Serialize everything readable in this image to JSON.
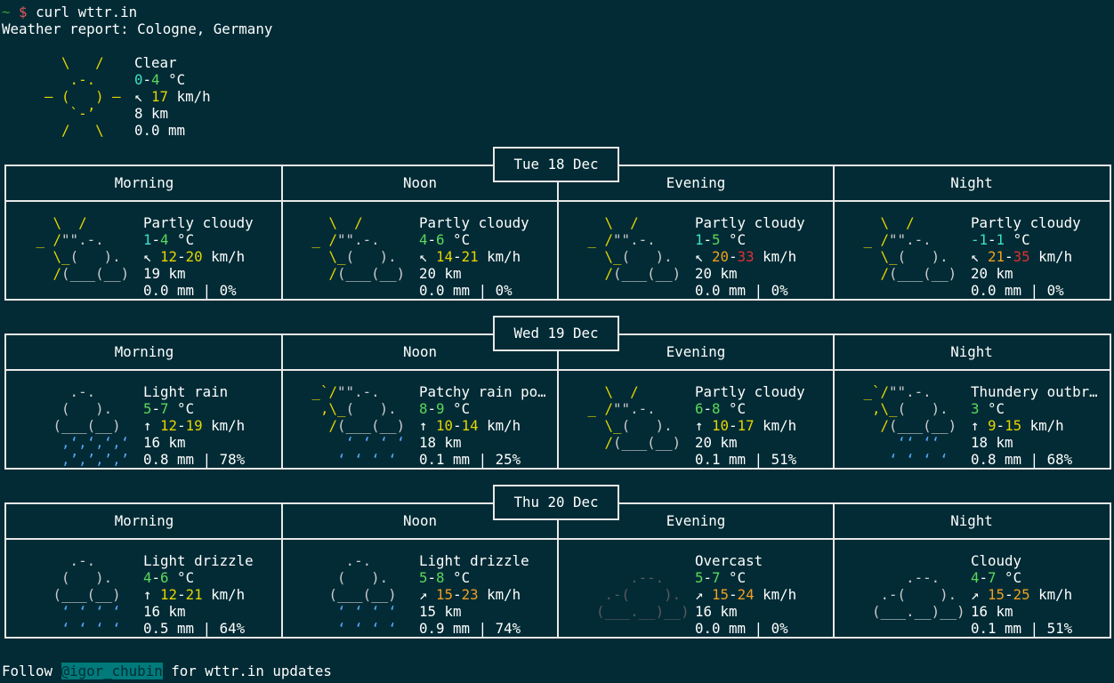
{
  "prompt": {
    "path": "~",
    "symbol": "$",
    "command": "curl wttr.in"
  },
  "report_title": "Weather report: Cologne, Germany",
  "current": {
    "condition": "Clear",
    "temp_low": "0",
    "temp_high": "4",
    "temp_unit": "°C",
    "wind_arrow": "↖",
    "wind": "17",
    "wind_unit": "km/h",
    "visibility": "8 km",
    "precip": "0.0 mm"
  },
  "days": [
    {
      "date": "Tue 18 Dec",
      "periods": [
        {
          "name": "Morning",
          "condition": "Partly cloudy",
          "t1": "1",
          "t2": "4",
          "wind_arrow": "↖",
          "w1": "12",
          "w2": "20",
          "vis": "19 km",
          "precip": "0.0 mm | 0%"
        },
        {
          "name": "Noon",
          "condition": "Partly cloudy",
          "t1": "4",
          "t2": "6",
          "wind_arrow": "↖",
          "w1": "14",
          "w2": "21",
          "vis": "20 km",
          "precip": "0.0 mm | 0%"
        },
        {
          "name": "Evening",
          "condition": "Partly cloudy",
          "t1": "1",
          "t2": "5",
          "wind_arrow": "↖",
          "w1": "20",
          "w2": "33",
          "vis": "20 km",
          "precip": "0.0 mm | 0%"
        },
        {
          "name": "Night",
          "condition": "Partly cloudy",
          "t1": "-1",
          "t2": "1",
          "wind_arrow": "↖",
          "w1": "21",
          "w2": "35",
          "vis": "20 km",
          "precip": "0.0 mm | 0%"
        }
      ]
    },
    {
      "date": "Wed 19 Dec",
      "periods": [
        {
          "name": "Morning",
          "condition": "Light rain",
          "t1": "5",
          "t2": "7",
          "wind_arrow": "↑",
          "w1": "12",
          "w2": "19",
          "vis": "16 km",
          "precip": "0.8 mm | 78%"
        },
        {
          "name": "Noon",
          "condition": "Patchy rain po…",
          "t1": "8",
          "t2": "9",
          "wind_arrow": "↑",
          "w1": "10",
          "w2": "14",
          "vis": "18 km",
          "precip": "0.1 mm | 25%"
        },
        {
          "name": "Evening",
          "condition": "Partly cloudy",
          "t1": "6",
          "t2": "8",
          "wind_arrow": "↑",
          "w1": "10",
          "w2": "17",
          "vis": "20 km",
          "precip": "0.1 mm | 51%"
        },
        {
          "name": "Night",
          "condition": "Thundery outbr…",
          "t1": "3",
          "t2": "",
          "wind_arrow": "↑",
          "w1": "9",
          "w2": "15",
          "vis": "18 km",
          "precip": "0.8 mm | 68%"
        }
      ]
    },
    {
      "date": "Thu 20 Dec",
      "periods": [
        {
          "name": "Morning",
          "condition": "Light drizzle",
          "t1": "4",
          "t2": "6",
          "wind_arrow": "↑",
          "w1": "12",
          "w2": "21",
          "vis": "16 km",
          "precip": "0.5 mm | 64%"
        },
        {
          "name": "Noon",
          "condition": "Light drizzle",
          "t1": "5",
          "t2": "8",
          "wind_arrow": "↗",
          "w1": "15",
          "w2": "23",
          "vis": "15 km",
          "precip": "0.9 mm | 74%"
        },
        {
          "name": "Evening",
          "condition": "Overcast",
          "t1": "5",
          "t2": "7",
          "wind_arrow": "↗",
          "w1": "15",
          "w2": "24",
          "vis": "16 km",
          "precip": "0.0 mm | 0%"
        },
        {
          "name": "Night",
          "condition": "Cloudy",
          "t1": "4",
          "t2": "7",
          "wind_arrow": "↗",
          "w1": "15",
          "w2": "25",
          "vis": "16 km",
          "precip": "0.1 mm | 51%"
        }
      ]
    }
  ],
  "footer": {
    "before": "Follow ",
    "handle": "@igor_chubin",
    "after": " for wttr.in updates"
  },
  "colors": {
    "background": "#022b35",
    "border": "#e8e8e8",
    "sun": "#e6d600",
    "temp_cold": "#3fe0c9",
    "temp_mild": "#5bd95b",
    "wind_low": "#e6d600",
    "wind_mid": "#f0a020",
    "wind_high": "#e03030",
    "rain": "#58a9ff",
    "cloud": "#cccccc",
    "cloud_dark": "#5a5a5a",
    "link_bg": "#007a7a"
  }
}
